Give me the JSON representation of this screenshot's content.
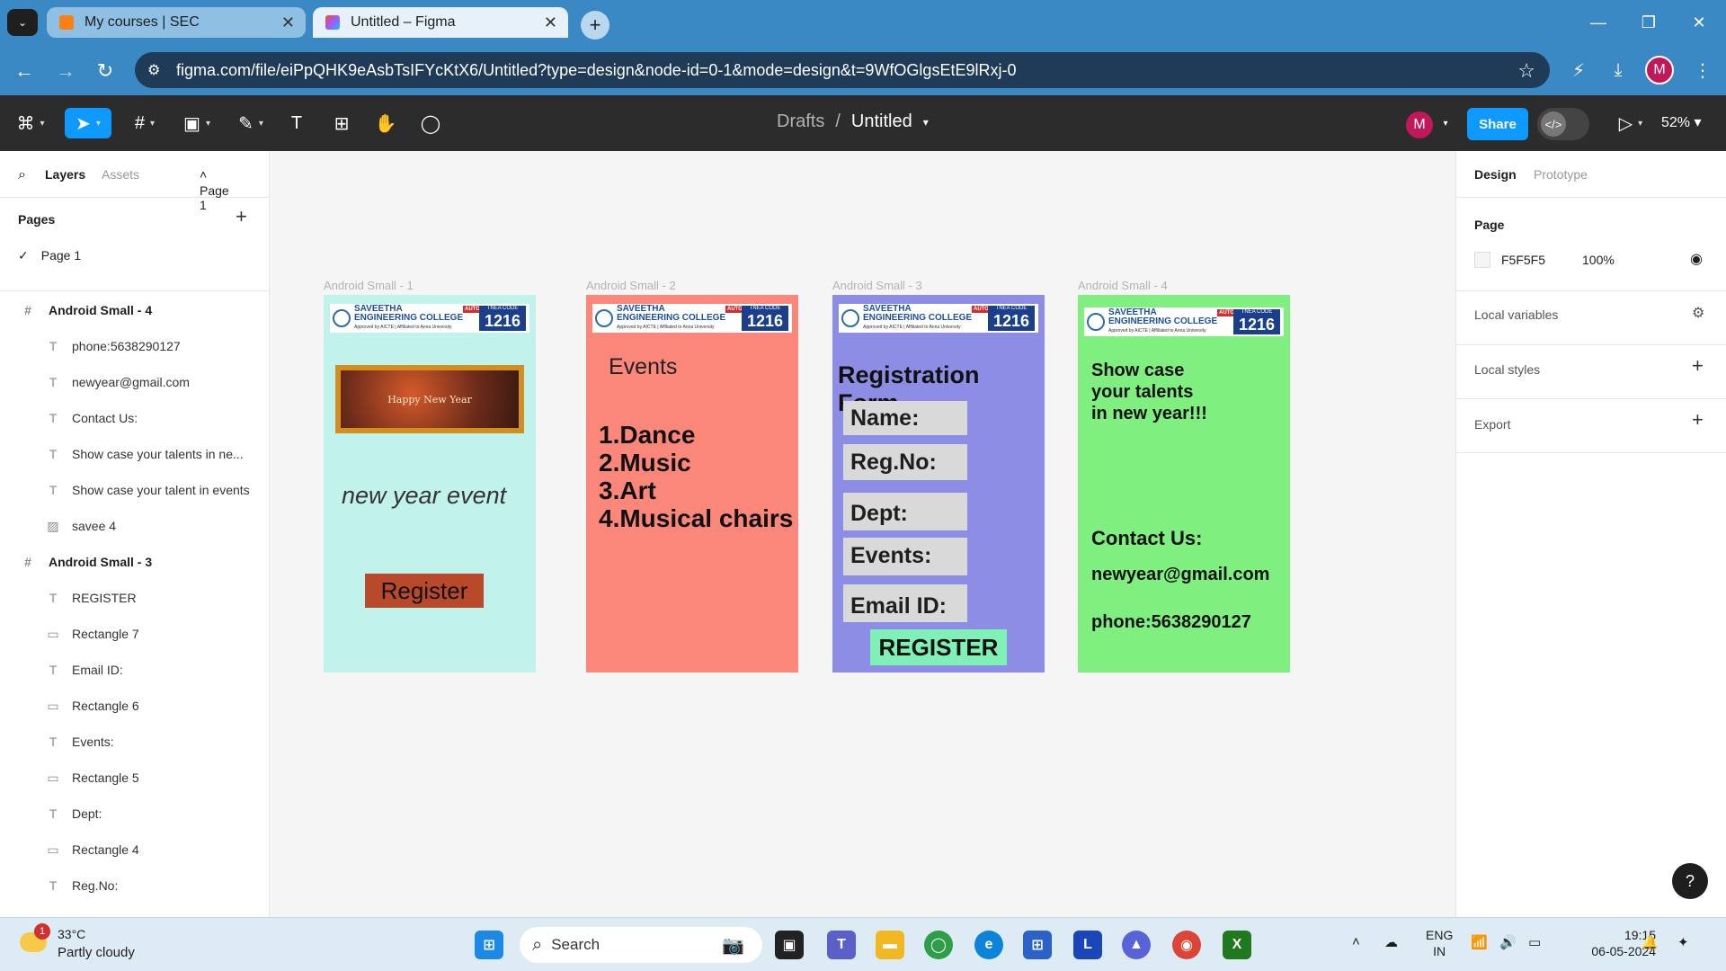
{
  "browser": {
    "tabs": [
      {
        "title": "My courses | SEC",
        "active": false
      },
      {
        "title": "Untitled – Figma",
        "active": true
      }
    ],
    "url": "figma.com/file/eiPpQHK9eAsbTsIFYcKtX6/Untitled?type=design&node-id=0-1&mode=design&t=9WfOGlgsEtE9lRxj-0",
    "profile_initial": "M"
  },
  "toolbar": {
    "breadcrumb_parent": "Drafts",
    "separator": "/",
    "file_name": "Untitled",
    "avatar_initial": "M",
    "share_label": "Share",
    "zoom": "52%"
  },
  "left_panel": {
    "tab_layers": "Layers",
    "tab_assets": "Assets",
    "page_selector": "Page 1",
    "pages_heading": "Pages",
    "pages": [
      "Page 1"
    ],
    "layers": [
      {
        "label": "Android Small - 4",
        "kind": "frame"
      },
      {
        "label": "phone:5638290127",
        "kind": "text"
      },
      {
        "label": "newyear@gmail.com",
        "kind": "text"
      },
      {
        "label": "Contact Us:",
        "kind": "text"
      },
      {
        "label": "Show case your talents in ne...",
        "kind": "text"
      },
      {
        "label": "Show case your talent in events",
        "kind": "text"
      },
      {
        "label": "savee 4",
        "kind": "image"
      },
      {
        "label": "Android Small - 3",
        "kind": "frame"
      },
      {
        "label": "REGISTER",
        "kind": "text"
      },
      {
        "label": "Rectangle 7",
        "kind": "rect"
      },
      {
        "label": "Email ID:",
        "kind": "text"
      },
      {
        "label": "Rectangle 6",
        "kind": "rect"
      },
      {
        "label": "Events:",
        "kind": "text"
      },
      {
        "label": "Rectangle 5",
        "kind": "rect"
      },
      {
        "label": "Dept:",
        "kind": "text"
      },
      {
        "label": "Rectangle 4",
        "kind": "rect"
      },
      {
        "label": "Reg.No:",
        "kind": "text"
      }
    ]
  },
  "right_panel": {
    "tab_design": "Design",
    "tab_prototype": "Prototype",
    "page_heading": "Page",
    "page_color": "F5F5F5",
    "page_opacity": "100%",
    "local_variables": "Local variables",
    "local_styles": "Local styles",
    "export": "Export",
    "help": "?"
  },
  "logo": {
    "name_line1": "SAVEETHA",
    "name_line2": "ENGINEERING COLLEGE",
    "autonomous": "AUTONOMOUS",
    "affiliation": "Approved by AICTE | Affiliated to Anna University",
    "code_label": "TNEA CODE",
    "code": "1216"
  },
  "canvas": {
    "frame1": {
      "label": "Android Small - 1",
      "banner_text": "Happy New Year",
      "tagline": "new year event",
      "button": "Register",
      "bg": "#c1f3ec"
    },
    "frame2": {
      "label": "Android Small - 2",
      "heading": "Events",
      "items": [
        "1.Dance",
        "2.Music",
        "3.Art",
        "4.Musical chairs"
      ],
      "bg": "#fb867a"
    },
    "frame3": {
      "label": "Android Small - 3",
      "heading": "Registration Form",
      "fields": [
        "Name:",
        "Reg.No:",
        "Dept:",
        "Events:",
        "Email ID:"
      ],
      "button": "REGISTER",
      "bg": "#8e8de6"
    },
    "frame4": {
      "label": "Android Small - 4",
      "heading_line1": "Show case",
      "heading_line2": "your talents",
      "heading_line3": "in new year!!!",
      "contact": "Contact Us:",
      "email": "newyear@gmail.com",
      "phone": "phone:5638290127",
      "bg": "#7ff07f"
    }
  },
  "taskbar": {
    "temperature": "33°C",
    "weather": "Partly cloudy",
    "weather_badge": "1",
    "search_placeholder": "Search",
    "lang_line1": "ENG",
    "lang_line2": "IN",
    "time": "19:15",
    "date": "06-05-2024"
  }
}
